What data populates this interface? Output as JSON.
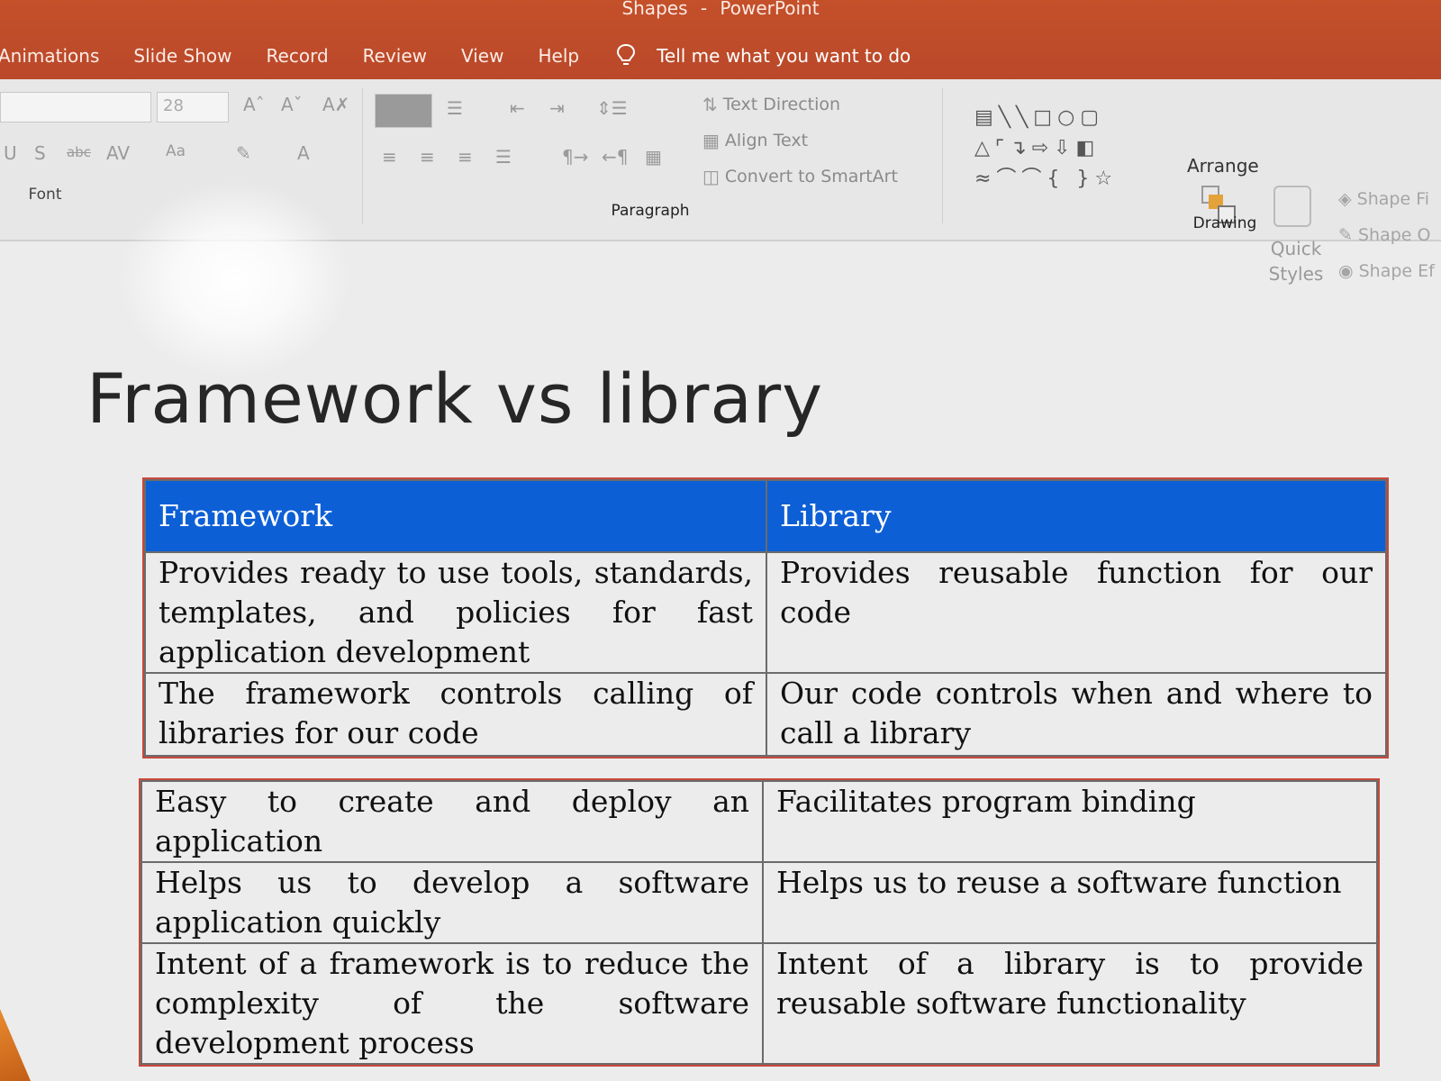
{
  "window": {
    "doc_name": "Shapes",
    "dash": "-",
    "app_name": "PowerPoint"
  },
  "menu": {
    "items": [
      "Animations",
      "Slide Show",
      "Record",
      "Review",
      "View",
      "Help"
    ],
    "tell_me": "Tell me what you want to do"
  },
  "ribbon": {
    "font_group": {
      "label": "Font",
      "size_value": "28"
    },
    "paragraph_group": {
      "label": "Paragraph",
      "text_direction": "Text Direction",
      "align_text": "Align Text",
      "convert_smartart": "Convert to SmartArt"
    },
    "drawing_group": {
      "label": "Drawing",
      "arrange": "Arrange",
      "quick_styles": "Quick Styles",
      "shape_fill": "Shape Fi",
      "shape_outline": "Shape O",
      "shape_effects": "Shape Ef"
    }
  },
  "slide": {
    "title": "Framework vs library",
    "table1": {
      "headers": [
        "Framework",
        "Library"
      ],
      "rows": [
        [
          "Provides ready to use tools, standards, templates, and policies for fast application development",
          "Provides reusable function for our code"
        ],
        [
          "The framework controls calling of libraries for our code",
          "Our code controls when and where to call a library"
        ]
      ]
    },
    "table2": {
      "rows": [
        [
          "Easy to create and deploy an application",
          "Facilitates program binding"
        ],
        [
          "Helps us to develop a software application quickly",
          "Helps us to reuse a software function"
        ],
        [
          "Intent of a framework is to reduce the complexity of the software development process",
          "Intent of a library is to provide reusable software functionality"
        ]
      ]
    }
  }
}
